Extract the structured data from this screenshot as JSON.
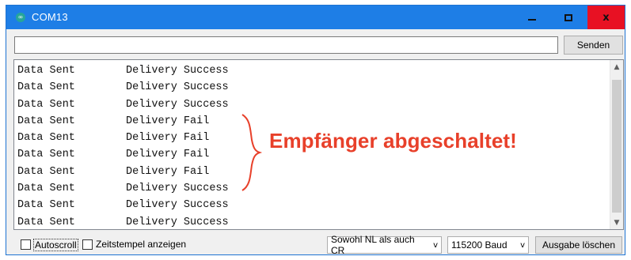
{
  "window": {
    "title": "COM13",
    "app_icon_glyph": "∞"
  },
  "titlebar": {
    "minimize_glyph": "",
    "close_glyph": "x"
  },
  "toolbar": {
    "send_input_value": "",
    "send_label": "Senden"
  },
  "output": {
    "lines": [
      {
        "col_a": "Data Sent",
        "col_b": "Delivery Success"
      },
      {
        "col_a": "Data Sent",
        "col_b": "Delivery Success"
      },
      {
        "col_a": "Data Sent",
        "col_b": "Delivery Success"
      },
      {
        "col_a": "Data Sent",
        "col_b": "Delivery Fail"
      },
      {
        "col_a": "Data Sent",
        "col_b": "Delivery Fail"
      },
      {
        "col_a": "Data Sent",
        "col_b": "Delivery Fail"
      },
      {
        "col_a": "Data Sent",
        "col_b": "Delivery Fail"
      },
      {
        "col_a": "Data Sent",
        "col_b": "Delivery Success"
      },
      {
        "col_a": "Data Sent",
        "col_b": "Delivery Success"
      },
      {
        "col_a": "Data Sent",
        "col_b": "Delivery Success"
      }
    ],
    "scroll_up_glyph": "▲",
    "scroll_down_glyph": "▼"
  },
  "annotation": {
    "text": "Empfänger abgeschaltet!",
    "color": "#e8402a"
  },
  "footer": {
    "autoscroll_label": "Autoscroll",
    "timestamp_label": "Zeitstempel anzeigen",
    "line_ending_value": "Sowohl NL als auch CR",
    "baud_value": "115200 Baud",
    "clear_label": "Ausgabe löschen",
    "dropdown_glyph": "v"
  },
  "colors": {
    "titlebar": "#1e7ee6",
    "close": "#e81123",
    "accent": "#1e73d2"
  }
}
